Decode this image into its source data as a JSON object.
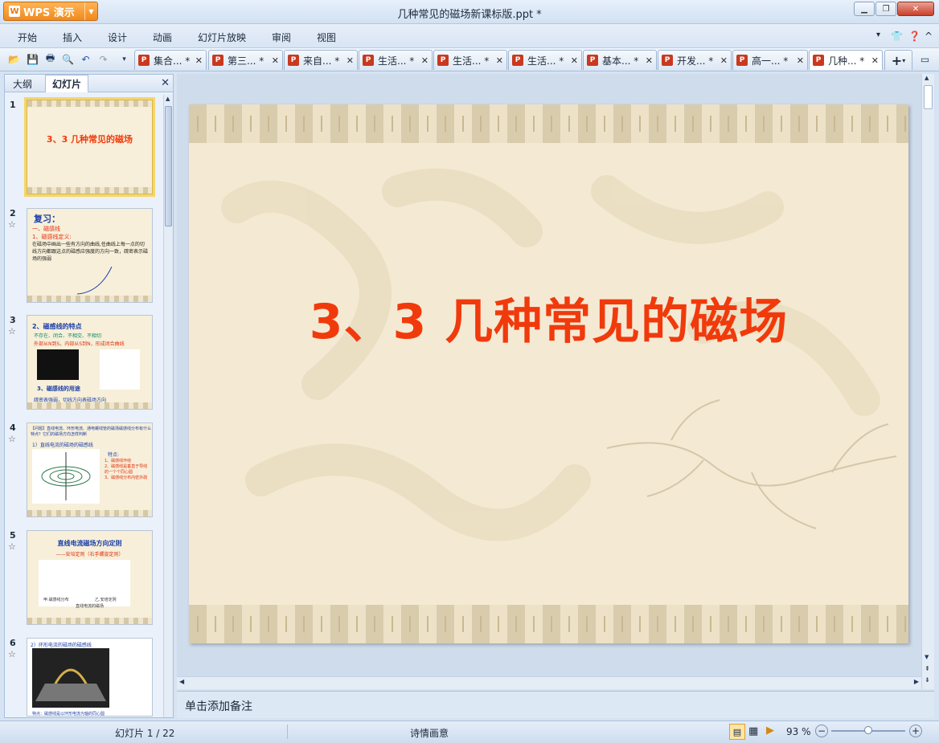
{
  "app": {
    "name": "WPS 演示",
    "logo_letter": "W"
  },
  "window": {
    "title": "几种常见的磁场新课标版.ppt *"
  },
  "menu": [
    "开始",
    "插入",
    "设计",
    "动画",
    "幻灯片放映",
    "审阅",
    "视图"
  ],
  "doc_tabs": [
    "集合... *",
    "第三... *",
    "来自... *",
    "生活... *",
    "生活... *",
    "生活... *",
    "基本... *",
    "开发... *",
    "高一... *",
    "几种... *"
  ],
  "panel": {
    "tab_outline": "大纲",
    "tab_slides": "幻灯片"
  },
  "thumbnails": [
    {
      "num": "1",
      "title": "3、3  几种常见的磁场"
    },
    {
      "num": "2",
      "title": "复习：",
      "lines": [
        "一、磁感线",
        "1、磁感线定义:",
        "在磁场中画出一些有方向的曲线,任曲线上每一点的切线方向都跟这点的磁感应强度的方向一致，疏密表示磁场的强弱"
      ]
    },
    {
      "num": "3",
      "title": "2、磁感线的特点",
      "lines": [
        "不存在、闭合、不相交、不相切",
        "外部从N到S，内部从S到N，形成闭合曲线",
        "3、磁感线的用途",
        "疏密表强弱，切线方向表磁场方向"
      ]
    },
    {
      "num": "4",
      "lines": [
        "【问题】直线电流、环形电流、通电螺线管的磁场磁感线分布有什么特点？它们的磁场方向怎样判断",
        "1）直线电流的磁场的磁感线",
        "特点:",
        "1、磁感线环绕",
        "2、磁感线是垂直于导线的一个个同心圆",
        "3、磁感线分布内密外疏"
      ]
    },
    {
      "num": "5",
      "title": "直线电流磁场方向定则",
      "lines": [
        "——安培定则（右手螺旋定则）",
        "甲.磁感线分布",
        "乙.安培定则",
        "直线电流的磁场"
      ]
    },
    {
      "num": "6",
      "lines": [
        "2）环形电流的磁场的磁感线",
        "特点：磁感线是以环形电流为轴的同心圆"
      ]
    }
  ],
  "slide": {
    "title": "3、3  几种常见的磁场"
  },
  "notes": {
    "placeholder": "单击添加备注"
  },
  "status": {
    "slide_counter": "幻灯片 1 / 22",
    "theme": "诗情画意",
    "zoom": "93 %",
    "zoom_level": 0.5
  }
}
